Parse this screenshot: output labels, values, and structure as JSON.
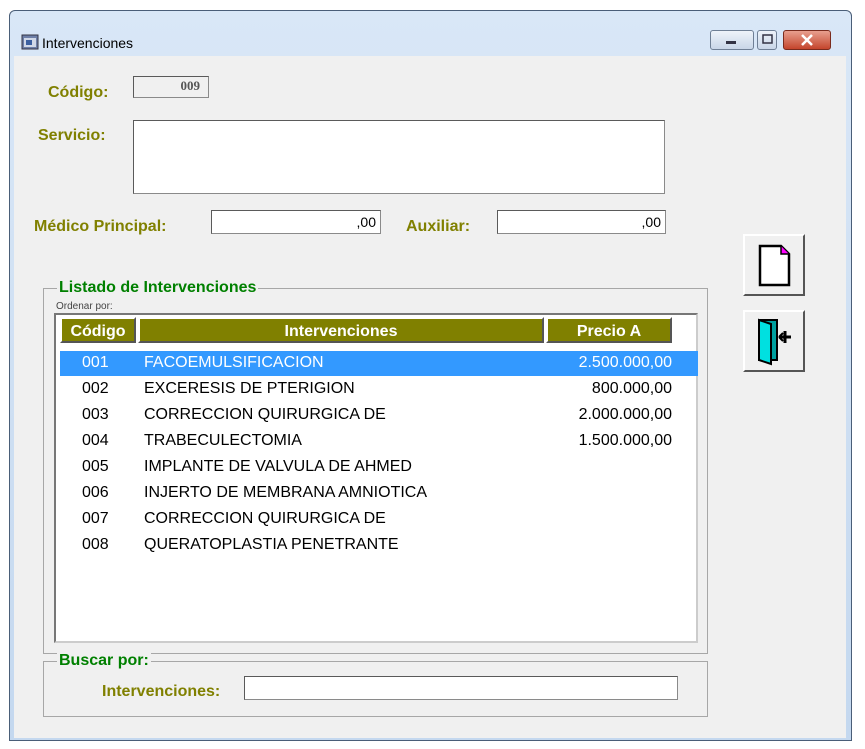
{
  "window": {
    "title": "Intervenciones"
  },
  "form": {
    "codigo_label": "Código:",
    "codigo_value": "009",
    "servicio_label": "Servicio:",
    "servicio_value": "",
    "medico_label": "Médico Principal:",
    "medico_value": ",00",
    "auxiliar_label": "Auxiliar:",
    "auxiliar_value": ",00"
  },
  "listado": {
    "title": "Listado de Intervenciones",
    "sort_label": "Ordenar por:",
    "columns": [
      "Código",
      "Intervenciones",
      "Precio A"
    ],
    "rows": [
      {
        "code": "001",
        "name": "FACOEMULSIFICACION",
        "price": "2.500.000,00",
        "selected": true
      },
      {
        "code": "002",
        "name": "EXCERESIS DE PTERIGION",
        "price": "800.000,00"
      },
      {
        "code": "003",
        "name": "CORRECCION QUIRURGICA DE",
        "price": "2.000.000,00"
      },
      {
        "code": "004",
        "name": "TRABECULECTOMIA",
        "price": "1.500.000,00"
      },
      {
        "code": "005",
        "name": "IMPLANTE DE VALVULA DE AHMED",
        "price": ""
      },
      {
        "code": "006",
        "name": "INJERTO DE MEMBRANA AMNIOTICA",
        "price": ""
      },
      {
        "code": "007",
        "name": "CORRECCION QUIRURGICA DE",
        "price": ""
      },
      {
        "code": "008",
        "name": "QUERATOPLASTIA PENETRANTE",
        "price": ""
      }
    ]
  },
  "buscar": {
    "title": "Buscar por:",
    "label": "Intervenciones:",
    "value": ""
  },
  "icons": {
    "new": "new-document-icon",
    "exit": "exit-door-icon",
    "app": "app-window-icon"
  },
  "colors": {
    "label_olive": "#808000",
    "group_green": "#008000",
    "selection": "#3399ff"
  }
}
